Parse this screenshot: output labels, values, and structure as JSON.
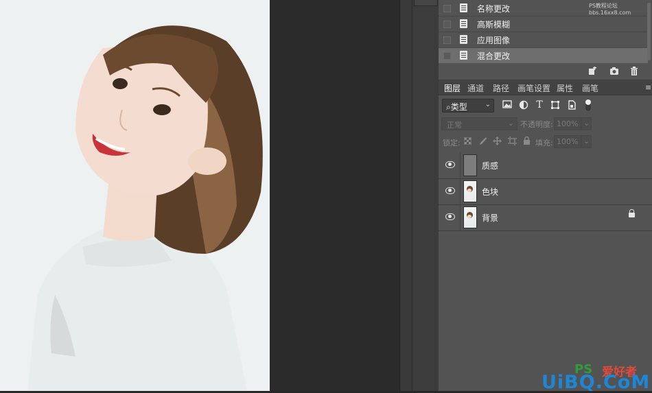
{
  "watermark_top": "PS教程论坛 bbs.16xx8.com",
  "history": {
    "items": [
      {
        "label": "名称更改",
        "selected": false
      },
      {
        "label": "高斯模糊",
        "selected": false
      },
      {
        "label": "应用图像",
        "selected": false
      },
      {
        "label": "混合更改",
        "selected": true
      }
    ],
    "tools": [
      "new-document-from-state-icon",
      "snapshot-camera-icon",
      "trash-icon"
    ]
  },
  "tabs": [
    {
      "label": "图层",
      "active": true
    },
    {
      "label": "通道",
      "active": false
    },
    {
      "label": "路径",
      "active": false
    },
    {
      "label": "画笔设置",
      "active": false
    },
    {
      "label": "属性",
      "active": false
    },
    {
      "label": "画笔",
      "active": false
    }
  ],
  "filter": {
    "kind_label": "类型",
    "icons": [
      "image-filter-icon",
      "adjustment-filter-icon",
      "type-filter-icon",
      "shape-filter-icon",
      "smart-object-filter-icon",
      "filter-toggle-icon"
    ]
  },
  "blend": {
    "mode": "正常",
    "opacity_label": "不透明度:",
    "opacity_value": "100%"
  },
  "lock": {
    "label": "锁定:",
    "fill_label": "填充:",
    "fill_value": "100%"
  },
  "layers": [
    {
      "name": "质感",
      "thumb": "gray",
      "visible": true,
      "locked": false
    },
    {
      "name": "色块",
      "thumb": "photo",
      "visible": true,
      "locked": false
    },
    {
      "name": "背景",
      "thumb": "photo",
      "visible": true,
      "locked": true
    }
  ],
  "watermark": {
    "ps": "PS",
    "cn": "爱好者",
    "brand": "UiBQ.CoM"
  },
  "colors": {
    "panel_bg": "#535353",
    "selected_row": "#6e6e6e",
    "canvas_bg": "#2b2b2b"
  }
}
